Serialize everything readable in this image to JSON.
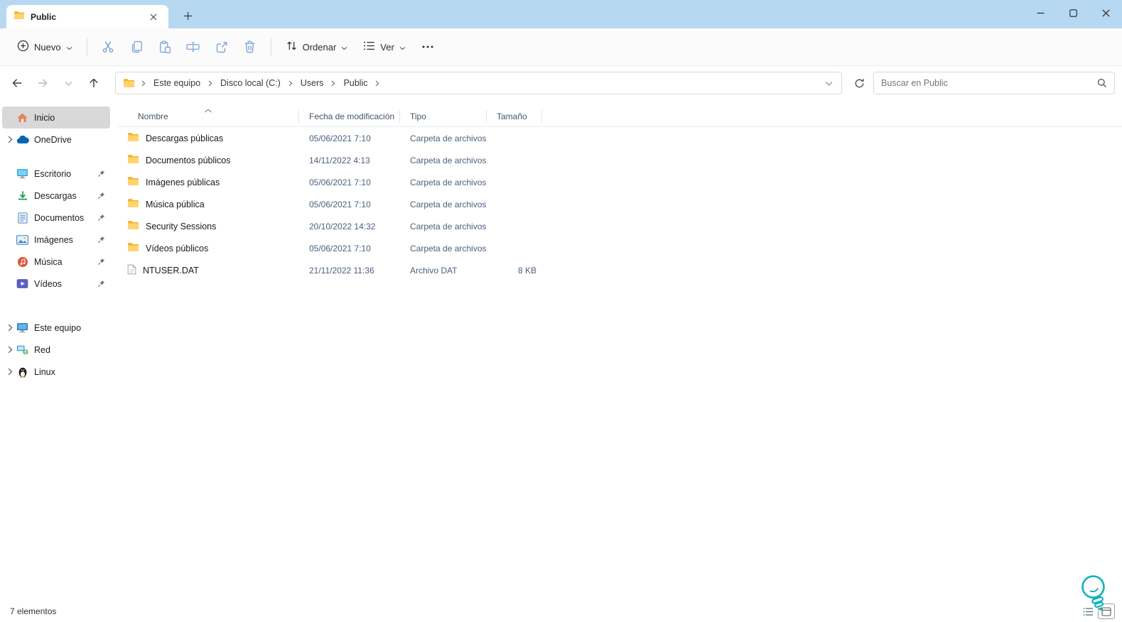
{
  "window": {
    "tab_title": "Public"
  },
  "toolbar": {
    "nuevo_label": "Nuevo",
    "ordenar_label": "Ordenar",
    "ver_label": "Ver",
    "icons": [
      "cut-icon",
      "copy-icon",
      "paste-icon",
      "rename-icon",
      "share-icon",
      "delete-icon",
      "more-icon"
    ]
  },
  "address": {
    "breadcrumbs": [
      "Este equipo",
      "Disco local (C:)",
      "Users",
      "Public"
    ],
    "search_placeholder": "Buscar en Public"
  },
  "sidebar": {
    "items": [
      {
        "label": "Inicio",
        "icon": "home-icon",
        "selected": true
      },
      {
        "label": "OneDrive",
        "icon": "onedrive-icon",
        "expandable": true
      },
      {
        "label": "Escritorio",
        "icon": "desktop-icon",
        "pinned": true
      },
      {
        "label": "Descargas",
        "icon": "downloads-icon",
        "pinned": true
      },
      {
        "label": "Documentos",
        "icon": "documents-icon",
        "pinned": true
      },
      {
        "label": "Imágenes",
        "icon": "pictures-icon",
        "pinned": true
      },
      {
        "label": "Música",
        "icon": "music-icon",
        "pinned": true
      },
      {
        "label": "Vídeos",
        "icon": "videos-icon",
        "pinned": true
      },
      {
        "label": "Este equipo",
        "icon": "computer-icon",
        "expandable": true
      },
      {
        "label": "Red",
        "icon": "network-icon",
        "expandable": true
      },
      {
        "label": "Linux",
        "icon": "linux-icon",
        "expandable": true
      }
    ]
  },
  "filelist": {
    "columns": {
      "name": "Nombre",
      "date": "Fecha de modificación",
      "type": "Tipo",
      "size": "Tamaño"
    },
    "rows": [
      {
        "name": "Descargas públicas",
        "date": "05/06/2021 7:10",
        "type": "Carpeta de archivos",
        "size": "",
        "icon": "folder-icon"
      },
      {
        "name": "Documentos públicos",
        "date": "14/11/2022 4:13",
        "type": "Carpeta de archivos",
        "size": "",
        "icon": "folder-icon"
      },
      {
        "name": "Imágenes públicas",
        "date": "05/06/2021 7:10",
        "type": "Carpeta de archivos",
        "size": "",
        "icon": "folder-icon"
      },
      {
        "name": "Música pública",
        "date": "05/06/2021 7:10",
        "type": "Carpeta de archivos",
        "size": "",
        "icon": "folder-icon"
      },
      {
        "name": "Security Sessions",
        "date": "20/10/2022 14:32",
        "type": "Carpeta de archivos",
        "size": "",
        "icon": "folder-icon"
      },
      {
        "name": "Vídeos públicos",
        "date": "05/06/2021 7:10",
        "type": "Carpeta de archivos",
        "size": "",
        "icon": "folder-icon"
      },
      {
        "name": "NTUSER.DAT",
        "date": "21/11/2022 11:36",
        "type": "Archivo DAT",
        "size": "8 KB",
        "icon": "file-icon"
      }
    ]
  },
  "statusbar": {
    "items_count": "7 elementos"
  },
  "colors": {
    "titlebar_bg": "#b7d8f1",
    "folder_yellow": "#ffd36e",
    "folder_tab": "#f0b42f",
    "selection_gray": "#d8d8d8",
    "toolbar_icon_blue": "#7aa3d4",
    "secondary_text": "#4a5f7d",
    "watermark_teal": "#12b2bd"
  }
}
